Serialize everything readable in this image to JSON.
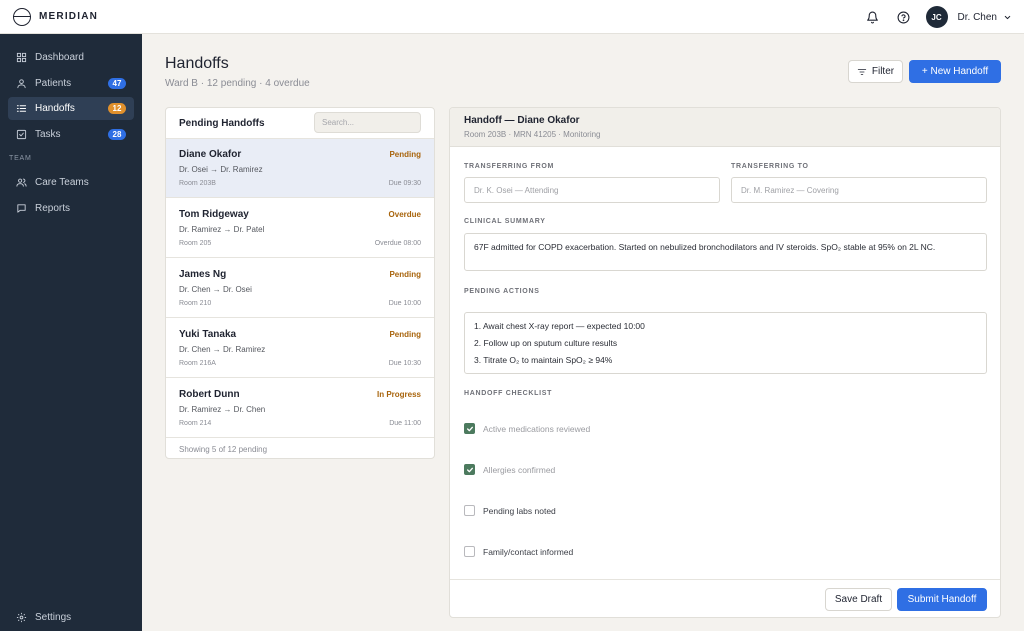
{
  "brand": {
    "name": "MERIDIAN",
    "icon": "meridian-logo-icon"
  },
  "topbar": {
    "icons": [
      "bell-icon",
      "help-circle-icon"
    ],
    "user": {
      "initials": "JC",
      "name": "Dr. Chen"
    }
  },
  "sidebar": {
    "items": [
      {
        "label": "Dashboard",
        "icon": "grid-icon"
      },
      {
        "label": "Patients",
        "icon": "user-icon",
        "badge": "47"
      },
      {
        "label": "Handoffs",
        "icon": "list-icon",
        "badge": "12"
      },
      {
        "label": "Tasks",
        "icon": "checkbox-icon",
        "badge": "28"
      }
    ],
    "section_label": "TEAM",
    "team_items": [
      {
        "label": "Care Teams",
        "icon": "users-icon"
      },
      {
        "label": "Reports",
        "icon": "message-icon"
      }
    ],
    "settings_label": "Settings",
    "colors": {
      "active_bg": "#2f3f55",
      "badge_blue": "#2f6fe4",
      "badge_orange": "#e0902c"
    }
  },
  "page": {
    "title": "Handoffs",
    "subtitle": "Ward B · 12 pending · 4 overdue",
    "filter_label": "Filter",
    "new_label": "+ New Handoff"
  },
  "list": {
    "title": "Pending Handoffs",
    "search_placeholder": "Search...",
    "rows": [
      {
        "name": "Diane Okafor",
        "status": "Pending",
        "route": "Dr. Osei → Dr. Ramirez",
        "room": "Room 203B",
        "due": "Due 09:30"
      },
      {
        "name": "Tom Ridgeway",
        "status": "Overdue",
        "route": "Dr. Ramirez → Dr. Patel",
        "room": "Room 205",
        "due": "Overdue 08:00"
      },
      {
        "name": "James Ng",
        "status": "Pending",
        "route": "Dr. Chen → Dr. Osei",
        "room": "Room 210",
        "due": "Due 10:00"
      },
      {
        "name": "Yuki Tanaka",
        "status": "Pending",
        "route": "Dr. Chen → Dr. Ramirez",
        "room": "Room 216A",
        "due": "Due 10:30"
      },
      {
        "name": "Robert Dunn",
        "status": "In Progress",
        "route": "Dr. Ramirez → Dr. Chen",
        "room": "Room 214",
        "due": "Due 11:00"
      }
    ],
    "footer": "Showing 5 of 12 pending",
    "status_color": "#a8640c"
  },
  "detail": {
    "title": "Handoff — Diane Okafor",
    "subtitle": "Room 203B · MRN 41205 · Monitoring",
    "from_label": "TRANSFERRING FROM",
    "from_placeholder": "Dr. K. Osei — Attending",
    "to_label": "TRANSFERRING TO",
    "to_placeholder": "Dr. M. Ramirez — Covering",
    "summary_label": "CLINICAL SUMMARY",
    "summary": "67F admitted for COPD exacerbation. Started on nebulized bronchodilators and IV steroids. SpO₂ stable at 95% on 2L NC.",
    "actions_label": "PENDING ACTIONS",
    "actions": [
      "1. Await chest X-ray report — expected 10:00",
      "2. Follow up on sputum culture results",
      "3. Titrate O₂ to maintain SpO₂ ≥ 94%"
    ],
    "checklist_label": "HANDOFF CHECKLIST",
    "checklist": [
      {
        "label": "Active medications reviewed",
        "checked": true
      },
      {
        "label": "Allergies confirmed",
        "checked": true
      },
      {
        "label": "Pending labs noted",
        "checked": false
      },
      {
        "label": "Family/contact informed",
        "checked": false
      }
    ],
    "save_label": "Save Draft",
    "submit_label": "Submit Handoff",
    "check_color": "#4c7a5e"
  }
}
